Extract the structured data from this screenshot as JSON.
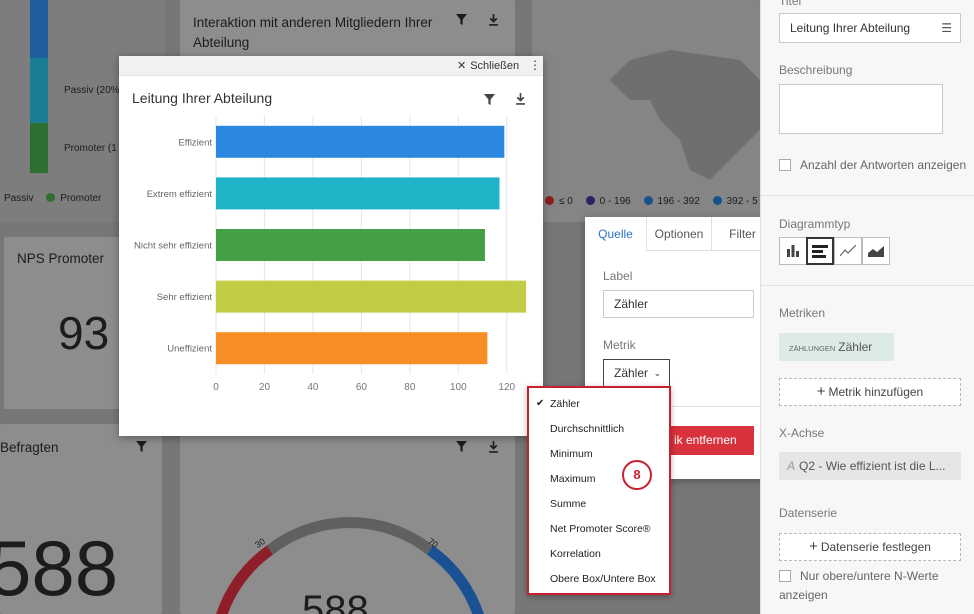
{
  "background": {
    "card_interaction_title_1": "Interaktion mit anderen Mitgliedern Ihrer",
    "card_interaction_title_2": "Abteilung",
    "nps_label_passive": "Passiv (20%)",
    "nps_label_promoter": "Promoter (1",
    "legend_passive": "Passiv",
    "legend_promoter": "Promoter",
    "nps_promoter_title": "NPS Promoter",
    "nps_promoter_value": "93",
    "respondents_title": "Befragten",
    "respondents_value": "588",
    "gauge_value": "588",
    "gauge_tick_left": "30",
    "gauge_tick_right": "70",
    "map_legend": [
      "≤ 0",
      "0 - 196",
      "196 - 392",
      "392 - 5"
    ],
    "colors": {
      "map_legend": [
        "#b52a2a",
        "#3b2f8c",
        "#1d6fb0",
        "#1d6fb0"
      ],
      "nps_passive": "#1a8aa0",
      "nps_promoter": "#2e7d32",
      "nps_top": "#1f66b0",
      "gauge_red": "#a32431",
      "gauge_blue": "#1e5fa6"
    }
  },
  "modal": {
    "close_label": "Schließen",
    "title": "Leitung Ihrer Abteilung"
  },
  "chart_data": {
    "type": "bar",
    "orientation": "horizontal",
    "title": "Leitung Ihrer Abteilung",
    "categories": [
      "Effizient",
      "Extrem effizient",
      "Nicht sehr effizient",
      "Sehr effizient",
      "Uneffizient"
    ],
    "values": [
      119,
      117,
      111,
      128,
      112
    ],
    "xlim": [
      0,
      130
    ],
    "xticks": [
      0,
      20,
      40,
      60,
      80,
      100,
      120
    ],
    "colors": [
      "#2b88e0",
      "#1fb3c8",
      "#43a047",
      "#c2cc44",
      "#f68d25"
    ],
    "grid": true
  },
  "panel": {
    "tabs": [
      "Quelle",
      "Optionen",
      "Filter"
    ],
    "active_tab": "Quelle",
    "label_title": "Label",
    "label_value": "Zähler",
    "metric_title": "Metrik",
    "metric_value": "Zähler",
    "remove_label": "ik entfernen"
  },
  "dropdown": {
    "options": [
      "Zähler",
      "Durchschnittlich",
      "Minimum",
      "Maximum",
      "Summe",
      "Net Promoter Score®",
      "Korrelation",
      "Obere Box/Untere Box"
    ],
    "selected": "Zähler",
    "step_badge": "8"
  },
  "sidebar": {
    "title_label": "Titel",
    "title_value": "Leitung Ihrer Abteilung",
    "description_label": "Beschreibung",
    "show_count_label": "Anzahl der Antworten anzeigen",
    "chart_type_label": "Diagrammtyp",
    "metrics_label": "Metriken",
    "metric_chip_prefix": "ZÄHLUNGEN",
    "metric_chip_label": "Zähler",
    "add_metric_label": "Metrik hinzufügen",
    "x_axis_label": "X-Achse",
    "x_axis_value": "Q2 - Wie effizient ist die L...",
    "series_label": "Datenserie",
    "set_series_label": "Datenserie festlegen",
    "top_n_label_1": "Nur obere/untere N-Werte",
    "top_n_label_2": "anzeigen"
  }
}
